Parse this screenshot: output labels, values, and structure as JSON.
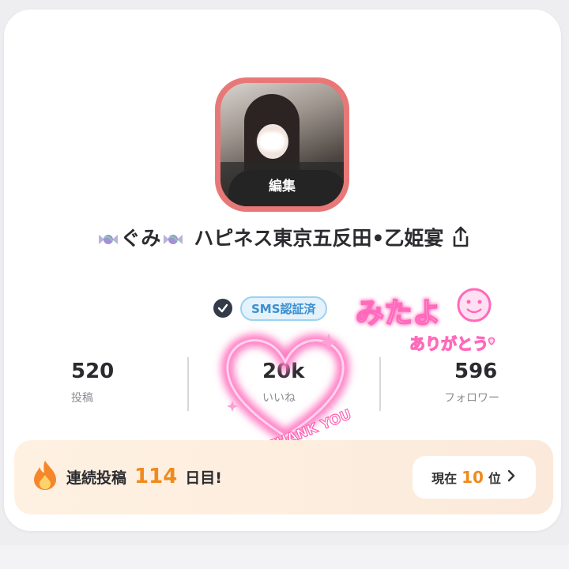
{
  "profile": {
    "edit_label": "編集",
    "name_part1": "ぐみ",
    "name_part2": "ハピネス東京五反田•乙姫宴",
    "verified_badge": "SMS認証済"
  },
  "stats": [
    {
      "value": "520",
      "label": "投稿"
    },
    {
      "value": "20k",
      "label": "いいね"
    },
    {
      "value": "596",
      "label": "フォロワー"
    }
  ],
  "streak": {
    "prefix": "連続投稿",
    "days": "114",
    "suffix": "日目!",
    "rank_prefix": "現在",
    "rank_number": "10",
    "rank_suffix": "位"
  },
  "stickers": {
    "thanks_text": "THANK YOU",
    "mitayo_text": "みたよ",
    "arigatou_text": "ありがとう"
  },
  "icons": {
    "candy": "candy-icon",
    "share": "share-icon",
    "check": "check-icon",
    "fire": "fire-icon",
    "chevron": "chevron-right-icon"
  },
  "colors": {
    "accent_orange": "#f08a1c",
    "avatar_border": "#e87878",
    "badge_blue": "#3a8fd0",
    "sticker_pink": "#ff5fb4"
  }
}
